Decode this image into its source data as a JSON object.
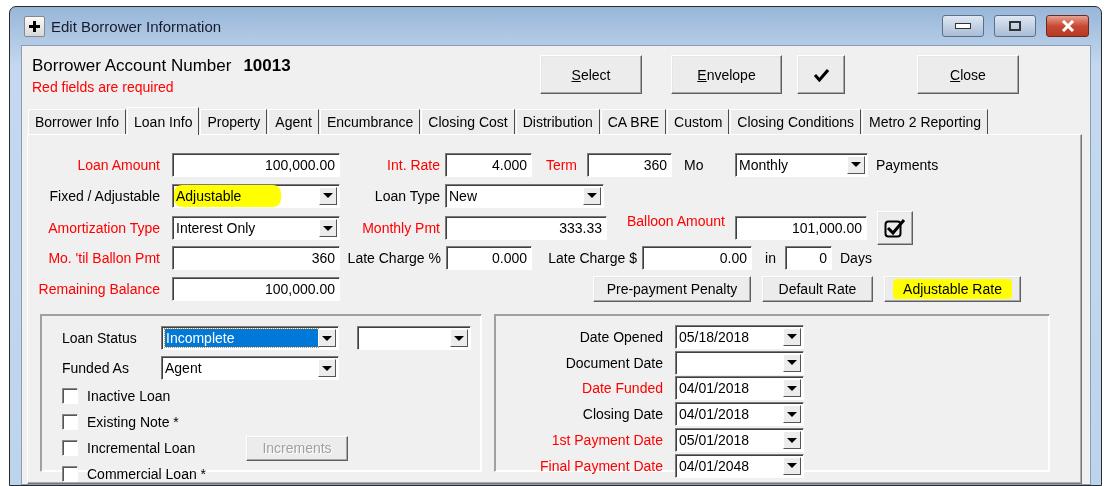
{
  "window": {
    "title": "Edit Borrower Information"
  },
  "header": {
    "account_label": "Borrower Account Number",
    "account_number": "10013",
    "note": "Red fields are required",
    "buttons": [
      {
        "kind": "text",
        "label": "Select",
        "mnemonic": true
      },
      {
        "kind": "text",
        "label": "Envelope",
        "mnemonic": true
      },
      {
        "kind": "check"
      },
      {
        "kind": "text",
        "label": "Close",
        "mnemonic": true
      }
    ]
  },
  "tabs": [
    {
      "label": "Borrower Info",
      "selected": false
    },
    {
      "label": "Loan Info",
      "selected": true
    },
    {
      "label": "Property",
      "selected": false
    },
    {
      "label": "Agent",
      "selected": false
    },
    {
      "label": "Encumbrance",
      "selected": false
    },
    {
      "label": "Closing Cost",
      "selected": false
    },
    {
      "label": "Distribution",
      "selected": false
    },
    {
      "label": "CA BRE",
      "selected": false
    },
    {
      "label": "Custom",
      "selected": false
    },
    {
      "label": "Closing Conditions",
      "selected": false
    },
    {
      "label": "Metro 2 Reporting",
      "selected": false
    }
  ],
  "loan_fields": [
    {
      "items": [
        {
          "kind": "label",
          "text": "Loan Amount",
          "required": true
        },
        {
          "kind": "field",
          "value": "100,000.00"
        },
        {
          "kind": "label",
          "text": "Int. Rate",
          "required": true
        },
        {
          "kind": "field",
          "value": "4.000"
        },
        {
          "kind": "label",
          "text": "Term",
          "required": true
        },
        {
          "kind": "field",
          "value": "360"
        },
        {
          "kind": "label",
          "text": "Mo",
          "required": false
        },
        {
          "kind": "select",
          "value": "Monthly",
          "highlighted": false
        },
        {
          "kind": "label",
          "text": "Payments",
          "required": false
        }
      ]
    },
    {
      "items": [
        {
          "kind": "label",
          "text": "Fixed / Adjustable",
          "required": false
        },
        {
          "kind": "select",
          "value": "Adjustable",
          "highlighted": true
        },
        {
          "kind": "label",
          "text": "Loan Type",
          "required": false
        },
        {
          "kind": "select",
          "value": "New",
          "highlighted": false
        }
      ]
    },
    {
      "items": [
        {
          "kind": "label",
          "text": "Amortization Type",
          "required": true
        },
        {
          "kind": "select",
          "value": "Interest Only",
          "highlighted": false
        },
        {
          "kind": "label",
          "text": "Monthly Pmt",
          "required": true
        },
        {
          "kind": "field",
          "value": "333.33"
        },
        {
          "kind": "label",
          "text": "Balloon Amount",
          "required": true
        },
        {
          "kind": "field",
          "value": "101,000.00"
        },
        {
          "kind": "check_button"
        }
      ]
    },
    {
      "items": [
        {
          "kind": "label",
          "text": "Mo. 'til Ballon Pmt",
          "required": true
        },
        {
          "kind": "field",
          "value": "360"
        },
        {
          "kind": "label",
          "text": "Late Charge %",
          "required": false
        },
        {
          "kind": "field",
          "value": "0.000"
        },
        {
          "kind": "label",
          "text": "Late Charge $",
          "required": false
        },
        {
          "kind": "field",
          "value": "0.00"
        },
        {
          "kind": "label",
          "text": "in",
          "required": false
        },
        {
          "kind": "field",
          "value": "0"
        },
        {
          "kind": "label",
          "text": "Days",
          "required": false
        }
      ]
    },
    {
      "items": [
        {
          "kind": "label",
          "text": "Remaining Balance",
          "required": true
        },
        {
          "kind": "field",
          "value": "100,000.00"
        },
        {
          "kind": "button",
          "label": "Pre-payment Penalty",
          "highlighted": false
        },
        {
          "kind": "button",
          "label": "Default Rate",
          "highlighted": false
        },
        {
          "kind": "button",
          "label": "Adjustable Rate",
          "highlighted": true
        }
      ]
    }
  ],
  "status_panel": {
    "rows": [
      {
        "label": "Loan Status",
        "selects": [
          {
            "value": "Incomplete",
            "focused": true
          },
          {
            "focused": false
          }
        ]
      },
      {
        "label": "Funded As",
        "selects": [
          {
            "value": "Agent",
            "focused": false
          }
        ]
      }
    ],
    "checkboxes": [
      {
        "label": "Inactive Loan",
        "checked": false
      },
      {
        "label": "Existing Note *",
        "checked": false
      },
      {
        "label": "Incremental Loan",
        "checked": false
      },
      {
        "label": "Commercial Loan *",
        "checked": false
      }
    ],
    "increments_button": {
      "label": "Increments",
      "disabled": true
    }
  },
  "dates": [
    {
      "label": "Date Opened",
      "required": false,
      "value": "05/18/2018"
    },
    {
      "label": "Document Date",
      "required": false
    },
    {
      "label": "Date Funded",
      "required": true,
      "value": "04/01/2018"
    },
    {
      "label": "Closing Date",
      "required": false,
      "value": "04/01/2018"
    },
    {
      "label": "1st Payment Date",
      "required": true,
      "value": "05/01/2018"
    },
    {
      "label": "Final Payment Date",
      "required": true,
      "value": "04/01/2048"
    }
  ]
}
